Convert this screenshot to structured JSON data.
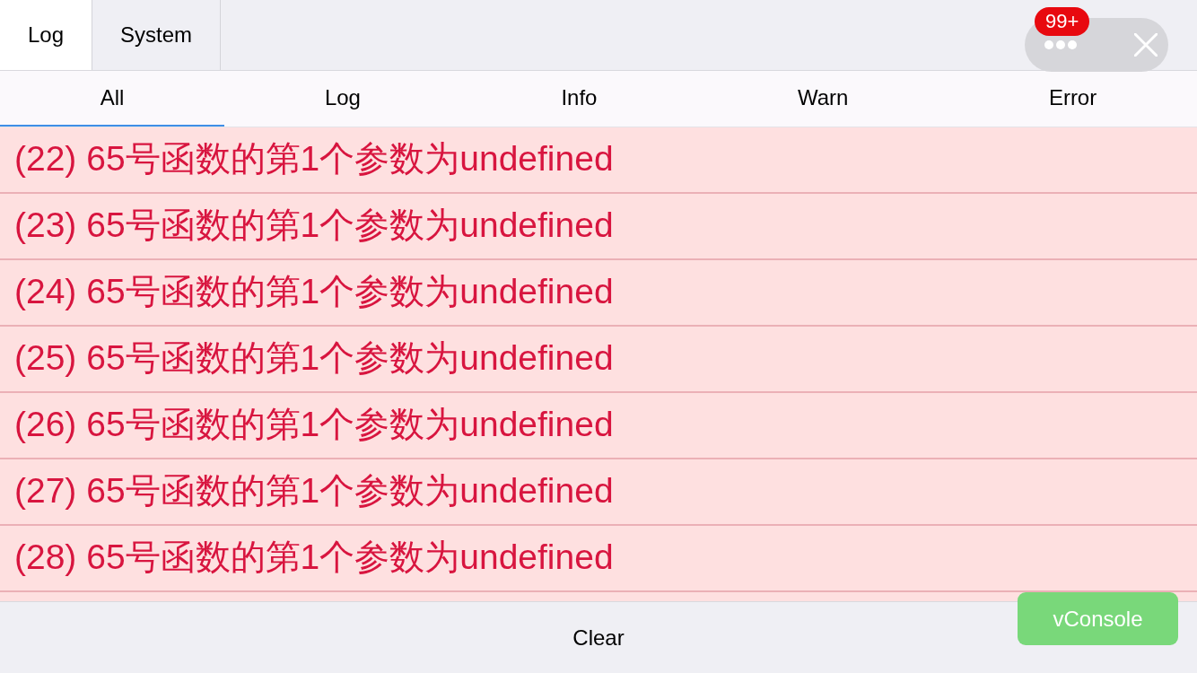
{
  "header_tabs": [
    {
      "label": "Log",
      "selected": true
    },
    {
      "label": "System",
      "selected": false
    }
  ],
  "toolbar": {
    "badge": "99+"
  },
  "filter_tabs": [
    {
      "label": "All",
      "selected": true
    },
    {
      "label": "Log",
      "selected": false
    },
    {
      "label": "Info",
      "selected": false
    },
    {
      "label": "Warn",
      "selected": false
    },
    {
      "label": "Error",
      "selected": false
    }
  ],
  "log_entries": [
    {
      "kind": "error",
      "text": "(22) 65号函数的第1个参数为undefined"
    },
    {
      "kind": "error",
      "text": "(23) 65号函数的第1个参数为undefined"
    },
    {
      "kind": "error",
      "text": "(24) 65号函数的第1个参数为undefined"
    },
    {
      "kind": "error",
      "text": "(25) 65号函数的第1个参数为undefined"
    },
    {
      "kind": "error",
      "text": "(26) 65号函数的第1个参数为undefined"
    },
    {
      "kind": "error",
      "text": "(27) 65号函数的第1个参数为undefined"
    },
    {
      "kind": "error",
      "text": "(28) 65号函数的第1个参数为undefined"
    }
  ],
  "footer": {
    "button": "Clear"
  },
  "launcher": {
    "label": "vConsole"
  }
}
